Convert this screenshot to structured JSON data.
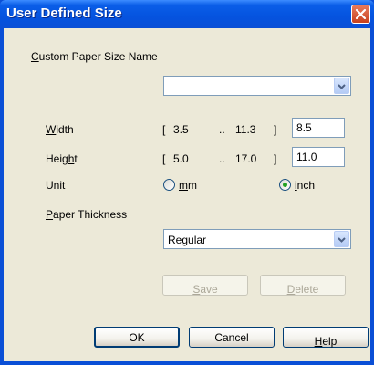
{
  "window": {
    "title": "User Defined Size"
  },
  "paper_size_name": {
    "label": "Custom Paper Size Name",
    "mnemonic": "C",
    "label_rest": "ustom Paper Size Name",
    "value": ""
  },
  "width": {
    "mnemonic": "W",
    "label_rest": "idth",
    "range_open": "[",
    "min": "3.5",
    "sep": "..",
    "max": "11.3",
    "range_close": "]",
    "value": "8.5"
  },
  "height": {
    "label_pre": "Heig",
    "mnemonic": "h",
    "label_rest": "t",
    "range_open": "[",
    "min": "5.0",
    "sep": "..",
    "max": "17.0",
    "range_close": "]",
    "value": "11.0"
  },
  "unit": {
    "label": "Unit",
    "options": [
      {
        "mnemonic": "m",
        "label_rest": "m",
        "selected": false
      },
      {
        "mnemonic": "i",
        "label_rest": "nch",
        "selected": true
      }
    ]
  },
  "paper_thickness": {
    "mnemonic": "P",
    "label_rest": "aper Thickness",
    "value": "Regular"
  },
  "buttons": {
    "save": {
      "mnemonic": "S",
      "label_rest": "ave",
      "enabled": false
    },
    "delete": {
      "mnemonic": "D",
      "label_rest": "elete",
      "enabled": false
    },
    "ok": {
      "label": "OK"
    },
    "cancel": {
      "label": "Cancel"
    },
    "help": {
      "mnemonic": "H",
      "label_rest": "elp"
    }
  },
  "colors": {
    "title_bar": "#0a4fd6",
    "dialog_bg": "#ece9d8",
    "close_button": "#c8401d",
    "radio_selected": "#21a121"
  }
}
